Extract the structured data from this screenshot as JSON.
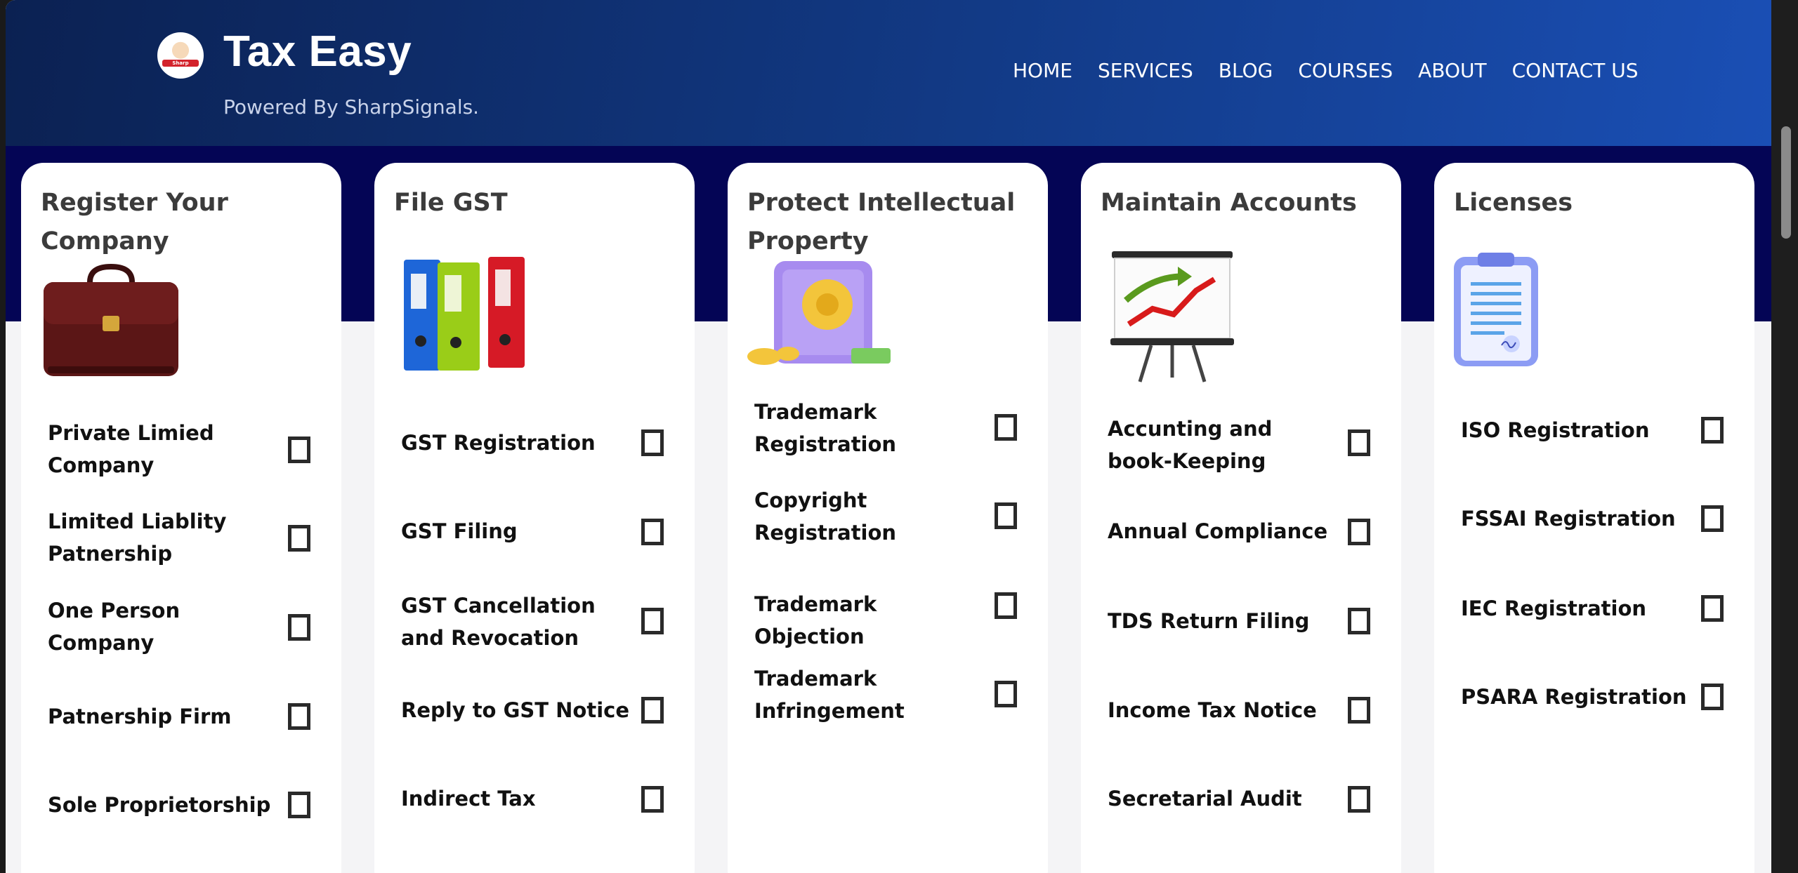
{
  "header": {
    "title": "Tax Easy",
    "subtitle": "Powered By SharpSignals.",
    "logo_tag": "Sharp Signals",
    "nav": [
      "HOME",
      "SERVICES",
      "BLOG",
      "COURSES",
      "ABOUT",
      "CONTACT US"
    ]
  },
  "cards": [
    {
      "title": "Register Your Company",
      "icon": "briefcase-icon",
      "items": [
        "Private Limied Company",
        "Limited Liablity Patnership",
        "One Person Company",
        "Patnership Firm",
        "Sole Proprietorship"
      ]
    },
    {
      "title": "File GST",
      "icon": "binders-icon",
      "items": [
        "GST Registration",
        "GST Filing",
        "GST Cancellation and Revocation",
        "Reply to GST Notice",
        "Indirect Tax"
      ]
    },
    {
      "title": "Protect Intellectual Property",
      "icon": "safe-icon",
      "items": [
        "Trademark Registration",
        "Copyright Registration",
        "Trademark Objection",
        "Trademark Infringement"
      ]
    },
    {
      "title": "Maintain Accounts",
      "icon": "chart-board-icon",
      "items": [
        "Accunting and book-Keeping",
        "Annual Compliance",
        "TDS Return Filing",
        "Income Tax Notice",
        "Secretarial Audit"
      ]
    },
    {
      "title": "Licenses",
      "icon": "clipboard-document-icon",
      "items": [
        "ISO Registration",
        "FSSAI Registration",
        "IEC Registration",
        "PSARA Registration"
      ]
    }
  ],
  "colors": {
    "header_start": "#0b2152",
    "header_end": "#1a4fb5",
    "band": "#040555",
    "card": "#ffffff"
  }
}
